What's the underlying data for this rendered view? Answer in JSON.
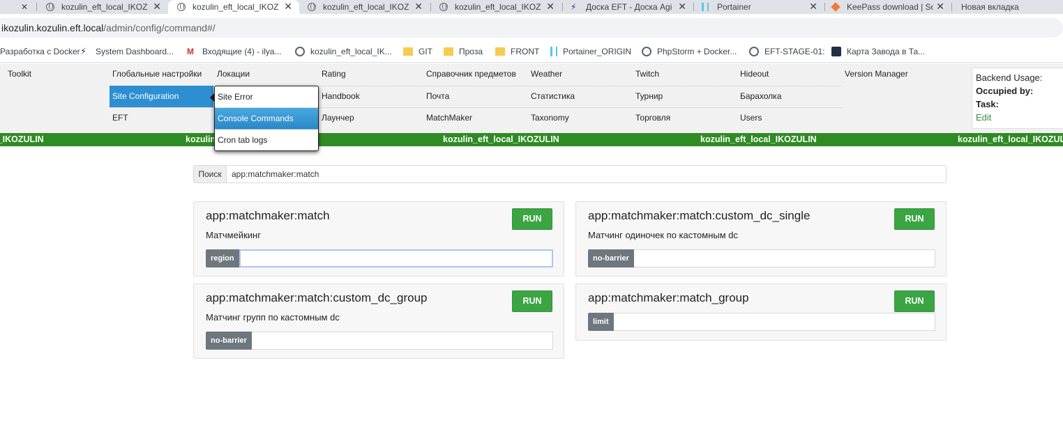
{
  "browser": {
    "tabs": [
      {
        "title": "kozulin_eft_local_IKOZULIN",
        "active": false
      },
      {
        "title": "kozulin_eft_local_IKOZULIN",
        "active": true
      },
      {
        "title": "kozulin_eft_local_IKOZULIN",
        "active": false
      },
      {
        "title": "kozulin_eft_local_IKOZULIN",
        "active": false
      },
      {
        "title": "Доска EFT - Доска Agile",
        "active": false
      },
      {
        "title": "Portainer",
        "active": false
      },
      {
        "title": "KeePass download | SourceForge",
        "active": false
      },
      {
        "title": "Новая вкладка",
        "active": false
      }
    ],
    "close_glyph": "✕",
    "url_host": "ikozulin.kozulin.eft.local",
    "url_path": "/admin/config/command#/",
    "bookmarks": [
      {
        "label": "Разработка с Docker",
        "icon": "none"
      },
      {
        "label": "System Dashboard...",
        "icon": "jira-icon"
      },
      {
        "label": "Входящие (4) - ilya...",
        "icon": "gmail-icon"
      },
      {
        "label": "kozulin_eft_local_IK...",
        "icon": "globe-icon"
      },
      {
        "label": "GIT",
        "icon": "folder-icon"
      },
      {
        "label": "Проза",
        "icon": "folder-icon"
      },
      {
        "label": "FRONT",
        "icon": "folder-icon"
      },
      {
        "label": "Portainer_ORIGIN",
        "icon": "portainer-icon"
      },
      {
        "label": "PhpStorm + Docker...",
        "icon": "globe-icon"
      },
      {
        "label": "EFT-STAGE-01:",
        "icon": "globe-icon"
      },
      {
        "label": "Карта Завода в Та...",
        "icon": "map-icon"
      }
    ]
  },
  "nav": {
    "row1": [
      "Toolkit",
      "Глобальные настройки",
      "Локации",
      "Rating",
      "Справочник предметов",
      "Weather",
      "Twitch",
      "Hideout",
      "Version Manager"
    ],
    "row2": [
      "Site Configuration",
      "Handbook",
      "Почта",
      "Статистика",
      "Турнир",
      "Барахолка"
    ],
    "row3": [
      "EFT",
      "Лаунчер",
      "MatchMaker",
      "Taxonomy",
      "Торговля",
      "Users"
    ],
    "dropdown": [
      "Site Error",
      "Console Commands",
      "Cron tab logs"
    ],
    "usage": {
      "title": "Backend Usage:",
      "occupied_label": "Occupied by:",
      "task_label": "Task:",
      "edit_label": "Edit"
    }
  },
  "env_banner": {
    "text": "kozulin_eft_local_IKOZULIN"
  },
  "search": {
    "label": "Поиск",
    "value": "app:matchmaker:match"
  },
  "commands": [
    {
      "name": "app:matchmaker:match",
      "description": "Матчмейкинг",
      "arg": "region",
      "run_label": "RUN"
    },
    {
      "name": "app:matchmaker:match:custom_dc_single",
      "description": "Матчинг одиночек по кастомным dc",
      "arg": "no-barrier",
      "run_label": "RUN"
    },
    {
      "name": "app:matchmaker:match:custom_dc_group",
      "description": "Матчинг групп по кастомным dc",
      "arg": "no-barrier",
      "run_label": "RUN"
    },
    {
      "name": "app:matchmaker:match_group",
      "description": "",
      "arg": "limit",
      "run_label": "RUN"
    }
  ],
  "colors": {
    "accent_green": "#3aa542",
    "env_green": "#2f8b23",
    "nav_selected": "#2d8fd1",
    "arg_label_bg": "#6e767e"
  }
}
